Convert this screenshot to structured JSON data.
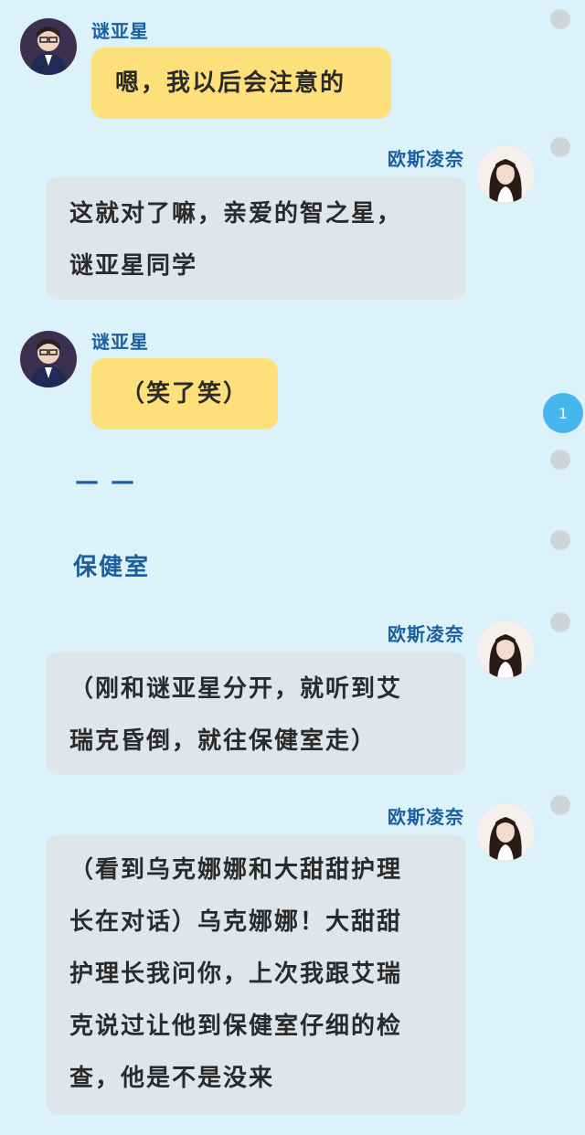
{
  "messages": [
    {
      "sender": "谜亚星",
      "text": "嗯，我以后会注意的"
    },
    {
      "sender": "欧斯凌奈",
      "lines": [
        "这就对了嘛，亲爱的智之星，",
        "谜亚星同学"
      ]
    },
    {
      "sender": "谜亚星",
      "text": "（笑了笑）"
    },
    {
      "sender": "欧斯凌奈",
      "lines": [
        "（刚和谜亚星分开，就听到艾",
        "瑞克昏倒，就往保健室走）"
      ]
    },
    {
      "sender": "欧斯凌奈",
      "lines": [
        "（看到乌克娜娜和大甜甜护理",
        "长在对话）乌克娜娜！大甜甜",
        "护理长我问你，上次我跟艾瑞",
        "克说过让他到保健室仔细的检",
        "查，他是不是没来"
      ]
    }
  ],
  "narration": {
    "dash": "— —",
    "scene": "保健室"
  },
  "badge": {
    "count": "1"
  },
  "colors": {
    "background": "#dcf2fb",
    "yellow_bubble": "#fde07a",
    "gray_bubble": "#e0e5ea",
    "name_blue": "#1c5fa0",
    "badge_blue": "#47b6ec"
  },
  "icons": {
    "side_dot": "circle-dot-icon",
    "avatar_boy": "avatar-miyaxing",
    "avatar_girl": "avatar-ousilingnai"
  }
}
